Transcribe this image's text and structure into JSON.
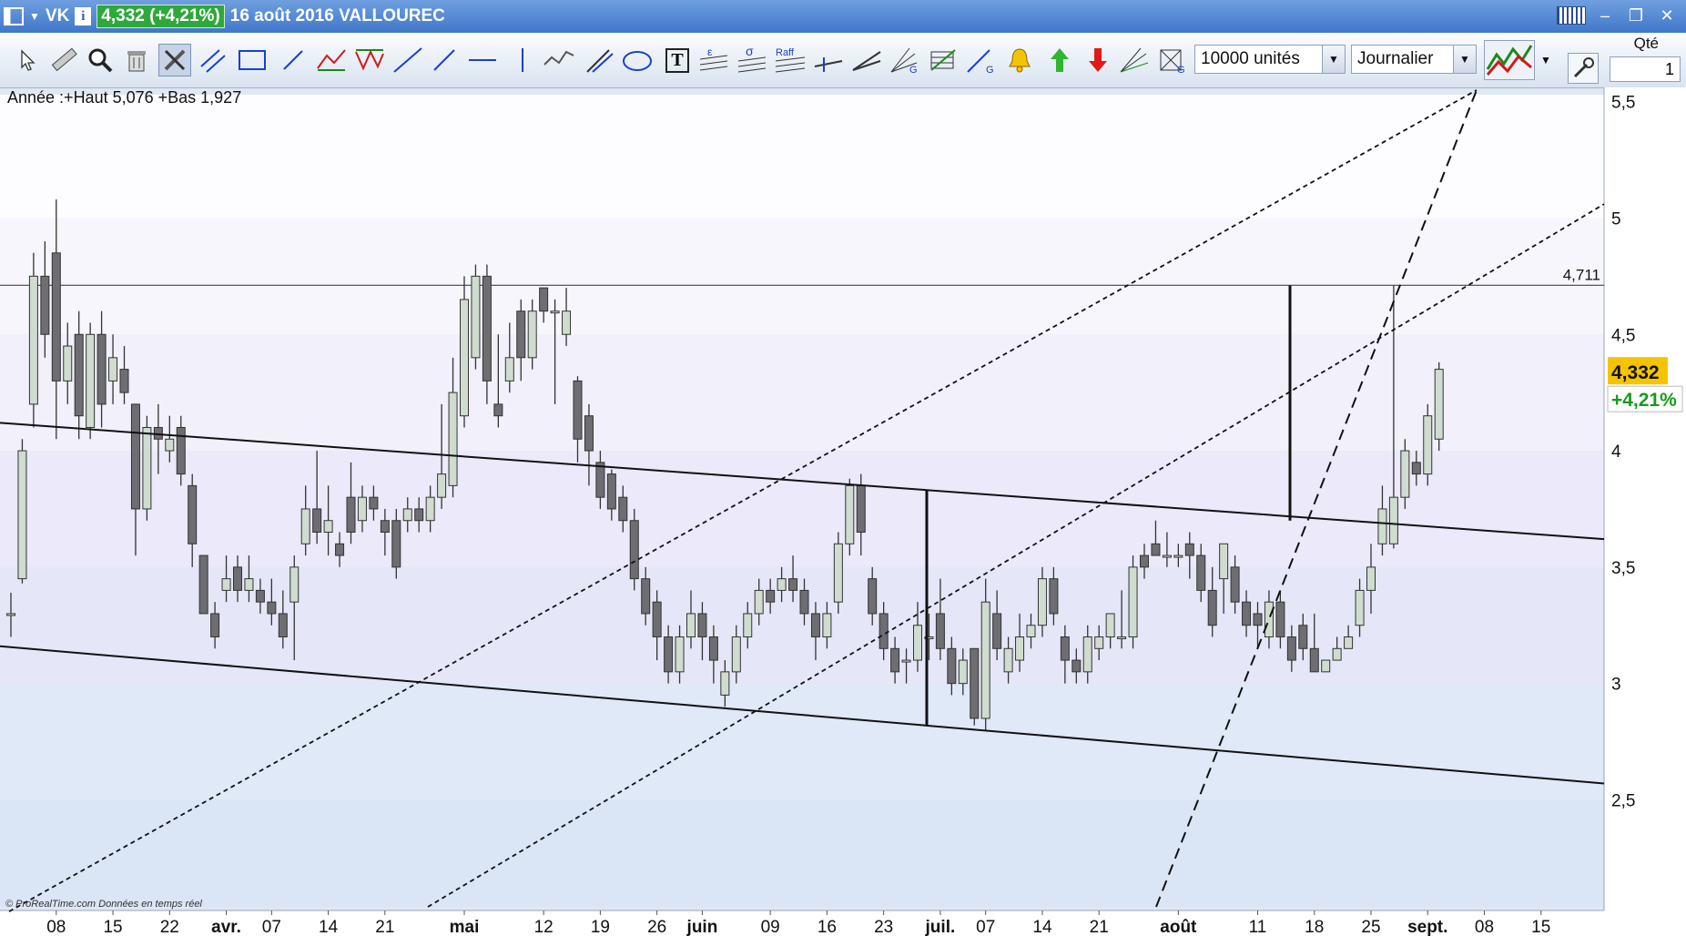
{
  "window": {
    "ticker": "VK",
    "price_badge": "4,332 (+4,21%)",
    "title": "16 août 2016 VALLOUREC"
  },
  "toolbar": {
    "units_value": "10000 unités",
    "period_value": "Journalier",
    "qte_label": "Qté",
    "qte_value": "1",
    "tool_labels": {
      "epsilon": "ε",
      "sigma": "σ",
      "raff": "Raff",
      "text": "T",
      "g": "G"
    },
    "icons": [
      "cursor-icon",
      "ruler-icon",
      "zoom-icon",
      "trash-icon",
      "tools-icon",
      "parallel-lines-icon",
      "rectangle-icon",
      "segment-icon",
      "zigzag-icon",
      "triangle-pattern-icon",
      "trendline-icon",
      "half-line-icon",
      "horizontal-line-icon",
      "vertical-line-icon",
      "channel-icon",
      "pitchfork-icon",
      "ellipse-icon",
      "text-icon",
      "fibonacci-icon",
      "stddev-icon",
      "raff-channel-icon",
      "gann-line-icon",
      "fan-icon",
      "gann-fan-icon",
      "grid-icon",
      "gann-angle-icon",
      "alert-bell-icon",
      "buy-arrow-icon",
      "sell-arrow-icon",
      "fibonacci-fan-icon",
      "gann-grid-icon",
      "chart-style-icon",
      "wrench-icon"
    ]
  },
  "chart_data": {
    "type": "candlestick",
    "title": "16 août 2016 VALLOUREC",
    "legend_text": "Année :+Haut 5,076 +Bas 1,927",
    "watermark": "© ProRealTime.com  Données en temps réel",
    "last_price": "4,332",
    "last_change": "+4,21%",
    "hline_value": 4.711,
    "hline_label": "4,711",
    "ylim": [
      2.04,
      5.53
    ],
    "y_ticks": [
      {
        "v": 5.5,
        "label": "5,5"
      },
      {
        "v": 5,
        "label": "5"
      },
      {
        "v": 4.5,
        "label": "4,5"
      },
      {
        "v": 4,
        "label": "4"
      },
      {
        "v": 3.5,
        "label": "3,5"
      },
      {
        "v": 3,
        "label": "3"
      },
      {
        "v": 2.5,
        "label": "2,5"
      }
    ],
    "x_ticks": [
      {
        "i": 4,
        "label": "08",
        "bold": false
      },
      {
        "i": 9,
        "label": "15",
        "bold": false
      },
      {
        "i": 14,
        "label": "22",
        "bold": false
      },
      {
        "i": 19,
        "label": "avr.",
        "bold": true
      },
      {
        "i": 23,
        "label": "07",
        "bold": false
      },
      {
        "i": 28,
        "label": "14",
        "bold": false
      },
      {
        "i": 33,
        "label": "21",
        "bold": false
      },
      {
        "i": 40,
        "label": "mai",
        "bold": true
      },
      {
        "i": 47,
        "label": "12",
        "bold": false
      },
      {
        "i": 52,
        "label": "19",
        "bold": false
      },
      {
        "i": 57,
        "label": "26",
        "bold": false
      },
      {
        "i": 61,
        "label": "juin",
        "bold": true
      },
      {
        "i": 67,
        "label": "09",
        "bold": false
      },
      {
        "i": 72,
        "label": "16",
        "bold": false
      },
      {
        "i": 77,
        "label": "23",
        "bold": false
      },
      {
        "i": 82,
        "label": "juil.",
        "bold": true
      },
      {
        "i": 86,
        "label": "07",
        "bold": false
      },
      {
        "i": 91,
        "label": "14",
        "bold": false
      },
      {
        "i": 96,
        "label": "21",
        "bold": false
      },
      {
        "i": 103,
        "label": "août",
        "bold": true
      },
      {
        "i": 110,
        "label": "11",
        "bold": false
      },
      {
        "i": 115,
        "label": "18",
        "bold": false
      },
      {
        "i": 120,
        "label": "25",
        "bold": false
      },
      {
        "i": 125,
        "label": "sept.",
        "bold": true
      },
      {
        "i": 130,
        "label": "08",
        "bold": false
      },
      {
        "i": 135,
        "label": "15",
        "bold": false
      }
    ],
    "candles": [
      [
        3.3,
        3.3,
        3.39,
        3.2
      ],
      [
        3.45,
        4.0,
        4.05,
        3.43
      ],
      [
        4.2,
        4.75,
        4.85,
        4.1
      ],
      [
        4.75,
        4.5,
        4.9,
        4.4
      ],
      [
        4.85,
        4.3,
        5.08,
        4.05
      ],
      [
        4.3,
        4.45,
        4.55,
        4.2
      ],
      [
        4.5,
        4.15,
        4.6,
        4.05
      ],
      [
        4.1,
        4.5,
        4.55,
        4.05
      ],
      [
        4.5,
        4.2,
        4.6,
        4.1
      ],
      [
        4.3,
        4.4,
        4.5,
        4.2
      ],
      [
        4.35,
        4.25,
        4.45,
        4.2
      ],
      [
        4.2,
        3.75,
        4.2,
        3.55
      ],
      [
        3.75,
        4.1,
        4.15,
        3.7
      ],
      [
        4.1,
        4.05,
        4.2,
        3.9
      ],
      [
        4.0,
        4.05,
        4.15,
        3.95
      ],
      [
        4.1,
        3.9,
        4.15,
        3.85
      ],
      [
        3.85,
        3.6,
        3.9,
        3.5
      ],
      [
        3.55,
        3.3,
        3.55,
        3.3
      ],
      [
        3.3,
        3.2,
        3.35,
        3.15
      ],
      [
        3.4,
        3.45,
        3.55,
        3.35
      ],
      [
        3.5,
        3.4,
        3.55,
        3.35
      ],
      [
        3.4,
        3.45,
        3.55,
        3.35
      ],
      [
        3.4,
        3.35,
        3.45,
        3.3
      ],
      [
        3.35,
        3.3,
        3.45,
        3.25
      ],
      [
        3.3,
        3.2,
        3.4,
        3.15
      ],
      [
        3.35,
        3.5,
        3.55,
        3.1
      ],
      [
        3.6,
        3.75,
        3.85,
        3.55
      ],
      [
        3.75,
        3.65,
        4.0,
        3.6
      ],
      [
        3.65,
        3.7,
        3.85,
        3.55
      ],
      [
        3.6,
        3.55,
        3.65,
        3.5
      ],
      [
        3.8,
        3.65,
        3.95,
        3.6
      ],
      [
        3.7,
        3.8,
        3.85,
        3.65
      ],
      [
        3.8,
        3.75,
        3.85,
        3.7
      ],
      [
        3.7,
        3.65,
        3.75,
        3.55
      ],
      [
        3.7,
        3.5,
        3.75,
        3.45
      ],
      [
        3.7,
        3.75,
        3.8,
        3.65
      ],
      [
        3.75,
        3.7,
        3.8,
        3.65
      ],
      [
        3.7,
        3.8,
        3.85,
        3.65
      ],
      [
        3.8,
        3.9,
        4.2,
        3.75
      ],
      [
        3.85,
        4.25,
        4.4,
        3.8
      ],
      [
        4.15,
        4.65,
        4.75,
        4.1
      ],
      [
        4.4,
        4.75,
        4.8,
        4.35
      ],
      [
        4.75,
        4.3,
        4.8,
        4.2
      ],
      [
        4.2,
        4.15,
        4.5,
        4.1
      ],
      [
        4.3,
        4.4,
        4.55,
        4.25
      ],
      [
        4.6,
        4.4,
        4.65,
        4.3
      ],
      [
        4.4,
        4.6,
        4.65,
        4.35
      ],
      [
        4.7,
        4.6,
        4.7,
        4.55
      ],
      [
        4.6,
        4.6,
        4.65,
        4.2
      ],
      [
        4.5,
        4.6,
        4.7,
        4.45
      ]
    ],
    "candles_b": [
      [
        4.3,
        4.05,
        4.32,
        3.95
      ],
      [
        4.15,
        4.0,
        4.2,
        3.85
      ],
      [
        3.95,
        3.8,
        4.0,
        3.75
      ],
      [
        3.9,
        3.75,
        3.92,
        3.7
      ],
      [
        3.8,
        3.7,
        3.85,
        3.65
      ],
      [
        3.7,
        3.45,
        3.75,
        3.4
      ],
      [
        3.45,
        3.3,
        3.5,
        3.25
      ],
      [
        3.35,
        3.2,
        3.4,
        3.1
      ],
      [
        3.2,
        3.05,
        3.25,
        3.0
      ],
      [
        3.05,
        3.2,
        3.25,
        3.0
      ],
      [
        3.2,
        3.3,
        3.4,
        3.15
      ],
      [
        3.3,
        3.2,
        3.35,
        3.1
      ],
      [
        3.2,
        3.1,
        3.25,
        3.0
      ],
      [
        2.95,
        3.05,
        3.1,
        2.9
      ],
      [
        3.05,
        3.2,
        3.25,
        3.0
      ],
      [
        3.2,
        3.3,
        3.35,
        3.15
      ],
      [
        3.3,
        3.4,
        3.45,
        3.25
      ],
      [
        3.4,
        3.35,
        3.45,
        3.3
      ],
      [
        3.4,
        3.45,
        3.5,
        3.35
      ],
      [
        3.45,
        3.4,
        3.55,
        3.35
      ],
      [
        3.4,
        3.3,
        3.45,
        3.25
      ],
      [
        3.3,
        3.2,
        3.35,
        3.1
      ],
      [
        3.2,
        3.3,
        3.35,
        3.15
      ],
      [
        3.35,
        3.6,
        3.65,
        3.3
      ],
      [
        3.6,
        3.85,
        3.88,
        3.55
      ],
      [
        3.85,
        3.65,
        3.9,
        3.55
      ],
      [
        3.45,
        3.3,
        3.5,
        3.25
      ],
      [
        3.3,
        3.15,
        3.35,
        3.1
      ],
      [
        3.15,
        3.05,
        3.2,
        3.0
      ],
      [
        3.1,
        3.1,
        3.15,
        3.0
      ],
      [
        3.1,
        3.25,
        3.35,
        3.05
      ],
      [
        3.2,
        3.2,
        3.3,
        3.1
      ],
      [
        3.3,
        3.15,
        3.45,
        3.1
      ],
      [
        3.15,
        3.0,
        3.2,
        2.95
      ],
      [
        3.0,
        3.1,
        3.15,
        2.95
      ],
      [
        3.15,
        2.85,
        3.15,
        2.82
      ],
      [
        2.85,
        3.35,
        3.45,
        2.8
      ],
      [
        3.3,
        3.15,
        3.4,
        3.1
      ],
      [
        3.05,
        3.15,
        3.2,
        3.0
      ],
      [
        3.1,
        3.2,
        3.3,
        3.05
      ]
    ],
    "candles_c": [
      [
        3.2,
        3.25,
        3.3,
        3.15
      ],
      [
        3.25,
        3.45,
        3.5,
        3.2
      ],
      [
        3.45,
        3.3,
        3.5,
        3.25
      ],
      [
        3.2,
        3.1,
        3.25,
        3.0
      ],
      [
        3.1,
        3.05,
        3.15,
        3.0
      ],
      [
        3.05,
        3.2,
        3.25,
        3.0
      ],
      [
        3.15,
        3.2,
        3.25,
        3.1
      ],
      [
        3.2,
        3.3,
        3.3,
        3.15
      ],
      [
        3.2,
        3.2,
        3.4,
        3.15
      ],
      [
        3.2,
        3.5,
        3.55,
        3.15
      ],
      [
        3.55,
        3.5,
        3.6,
        3.45
      ],
      [
        3.6,
        3.55,
        3.7,
        3.55
      ],
      [
        3.55,
        3.55,
        3.65,
        3.5
      ],
      [
        3.55,
        3.55,
        3.6,
        3.5
      ],
      [
        3.6,
        3.55,
        3.65,
        3.45
      ],
      [
        3.55,
        3.4,
        3.6,
        3.35
      ],
      [
        3.4,
        3.25,
        3.5,
        3.2
      ],
      [
        3.45,
        3.6,
        3.6,
        3.3
      ],
      [
        3.5,
        3.35,
        3.55,
        3.3
      ],
      [
        3.35,
        3.25,
        3.4,
        3.2
      ],
      [
        3.3,
        3.25,
        3.35,
        3.15
      ],
      [
        3.2,
        3.35,
        3.4,
        3.15
      ],
      [
        3.35,
        3.2,
        3.4,
        3.15
      ],
      [
        3.2,
        3.1,
        3.25,
        3.05
      ],
      [
        3.25,
        3.15,
        3.3,
        3.1
      ],
      [
        3.15,
        3.05,
        3.3,
        3.05
      ],
      [
        3.05,
        3.1,
        3.1,
        3.05
      ],
      [
        3.1,
        3.15,
        3.2,
        3.1
      ],
      [
        3.15,
        3.2,
        3.25,
        3.15
      ],
      [
        3.25,
        3.4,
        3.45,
        3.2
      ],
      [
        3.4,
        3.5,
        3.6,
        3.3
      ],
      [
        3.6,
        3.75,
        3.85,
        3.55
      ]
    ],
    "candles_d": [
      [
        3.6,
        3.8,
        4.71,
        3.58
      ],
      [
        3.8,
        4.0,
        4.05,
        3.75
      ],
      [
        3.95,
        3.9,
        4.0,
        3.85
      ],
      [
        3.9,
        4.15,
        4.2,
        3.85
      ],
      [
        4.05,
        4.35,
        4.38,
        4.0
      ]
    ]
  }
}
